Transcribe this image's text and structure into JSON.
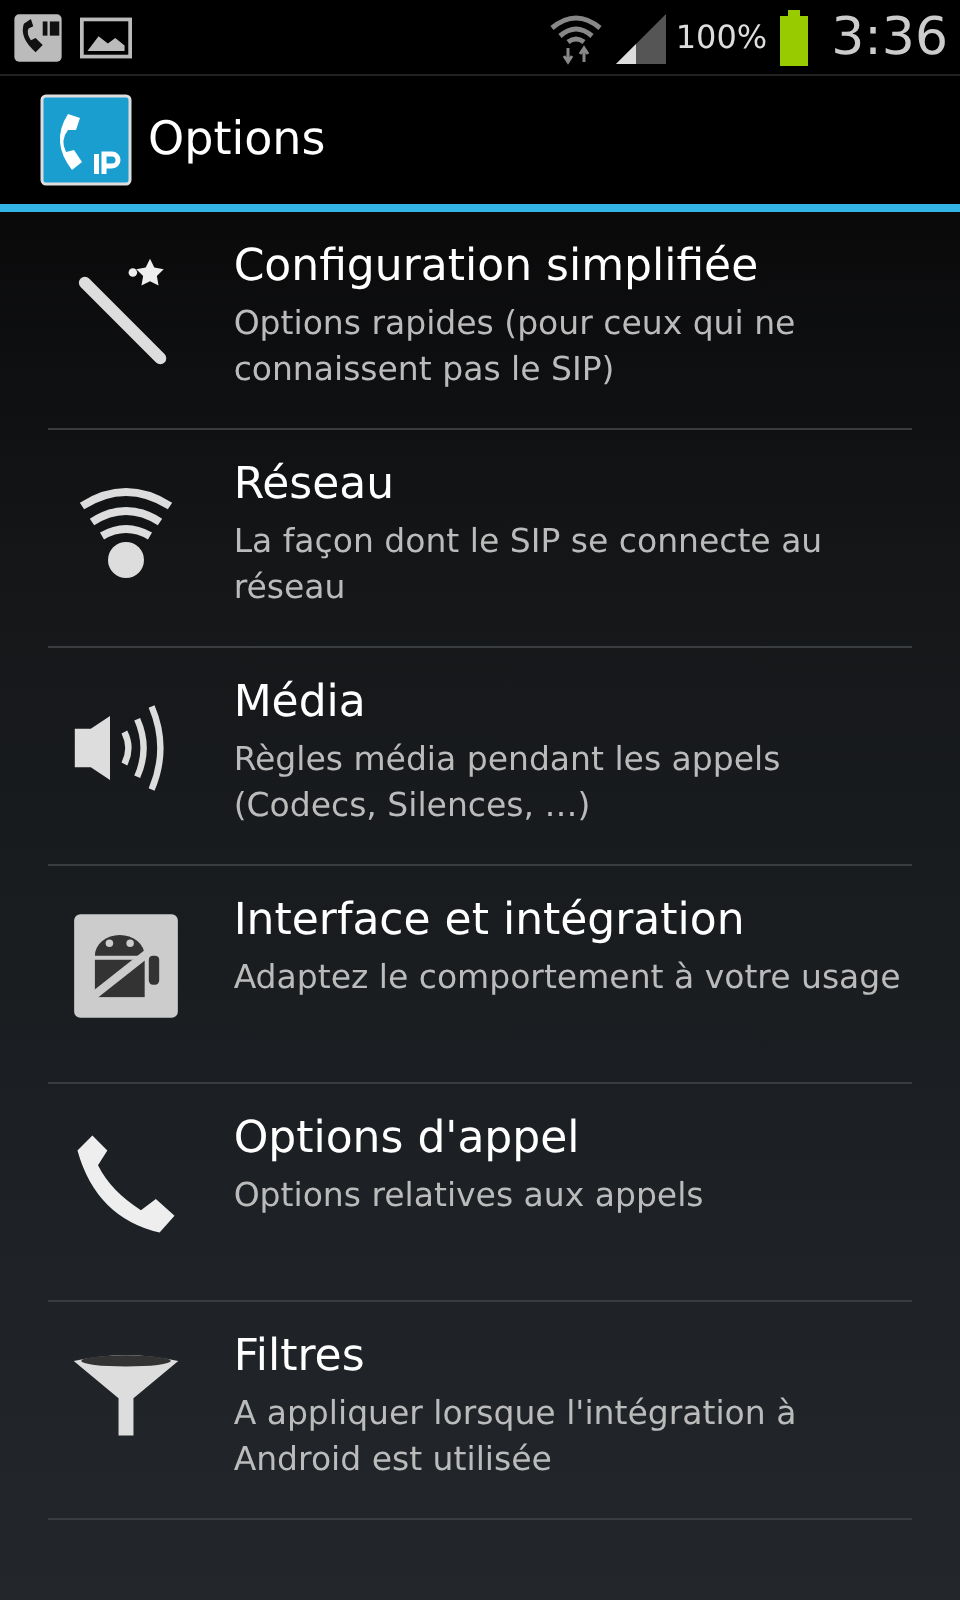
{
  "status_bar": {
    "battery": "100%",
    "time": "3:36"
  },
  "action_bar": {
    "title": "Options"
  },
  "items": [
    {
      "kind": "wand",
      "title": "Configuration simplifiée",
      "summary": "Options rapides (pour ceux qui ne connaissent pas le SIP)"
    },
    {
      "kind": "wifi",
      "title": "Réseau",
      "summary": "La façon dont le SIP se connecte au réseau"
    },
    {
      "kind": "speaker",
      "title": "Média",
      "summary": "Règles média pendant les appels (Codecs, Silences, …)"
    },
    {
      "kind": "android",
      "title": "Interface et intégration",
      "summary": "Adaptez le comportement à votre usage"
    },
    {
      "kind": "phone",
      "title": "Options d'appel",
      "summary": "Options relatives aux appels"
    },
    {
      "kind": "funnel",
      "title": "Filtres",
      "summary": "A appliquer lorsque l'intégration à Android est utilisée"
    }
  ]
}
